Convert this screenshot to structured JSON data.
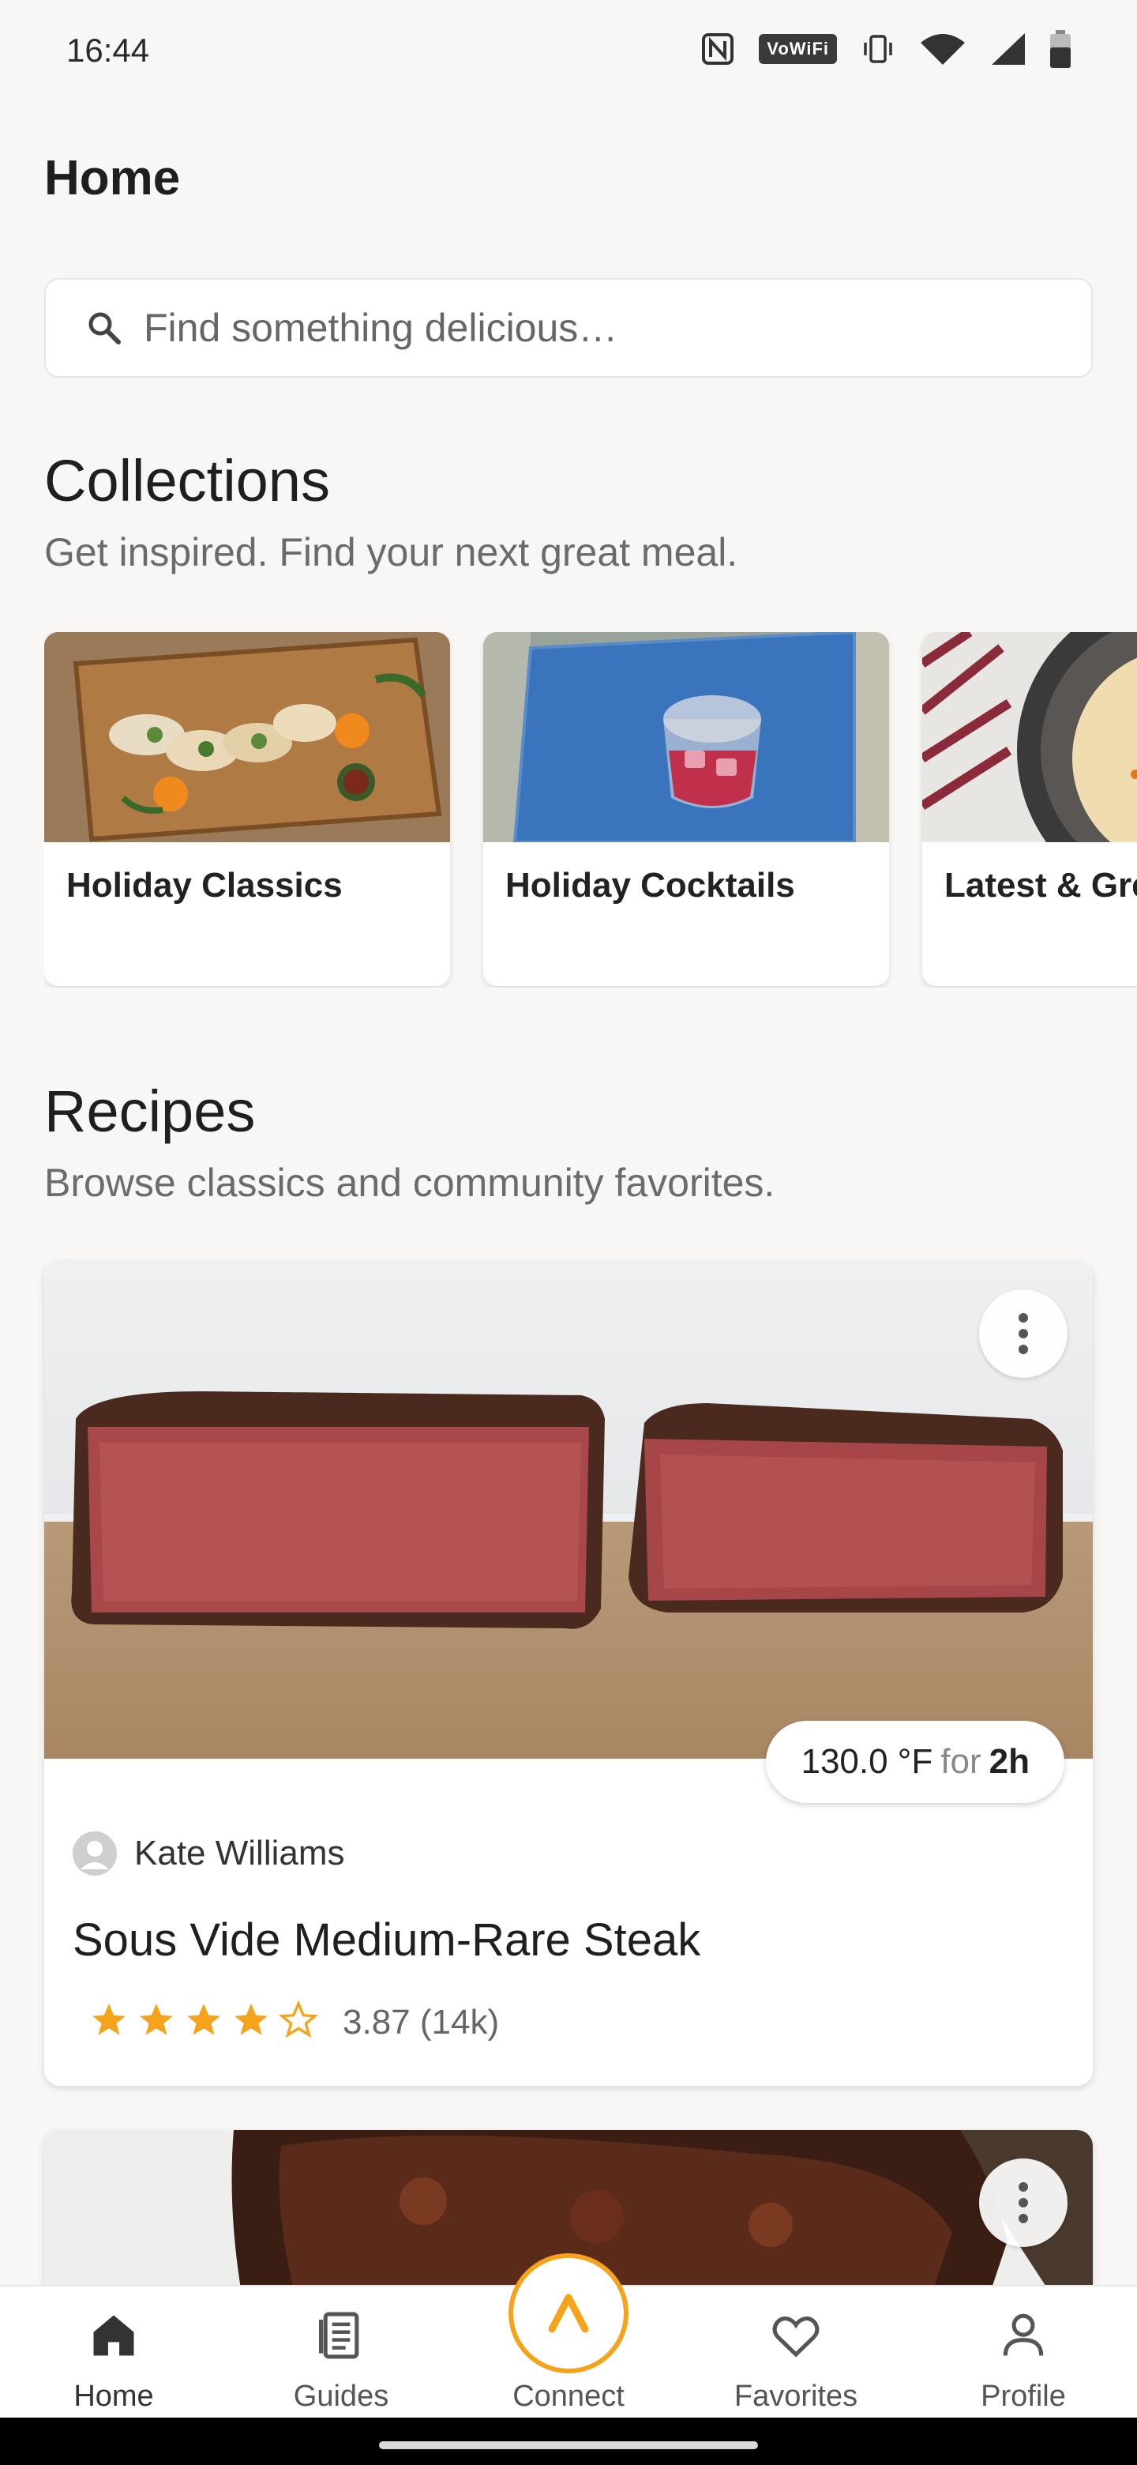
{
  "status_bar": {
    "time": "16:44",
    "wifi_badge": "VoWiFi"
  },
  "header": {
    "title": "Home"
  },
  "search": {
    "placeholder": "Find something delicious…"
  },
  "collections": {
    "title": "Collections",
    "subtitle": "Get inspired. Find your next great meal.",
    "items": [
      {
        "label": "Holiday Classics"
      },
      {
        "label": "Holiday Cocktails"
      },
      {
        "label": "Latest & Greatest"
      }
    ]
  },
  "recipes": {
    "title": "Recipes",
    "subtitle": "Browse classics and community favorites.",
    "items": [
      {
        "author": "Kate Williams",
        "title": "Sous Vide Medium-Rare Steak",
        "temp": "130.0 °F",
        "temp_for": "for",
        "duration": "2h",
        "rating_value": 3.87,
        "rating_text": "3.87 (14k)"
      }
    ]
  },
  "bottom_nav": {
    "items": [
      {
        "label": "Home",
        "icon": "home-icon"
      },
      {
        "label": "Guides",
        "icon": "guides-icon"
      },
      {
        "label": "Connect",
        "icon": "connect-icon"
      },
      {
        "label": "Favorites",
        "icon": "heart-icon"
      },
      {
        "label": "Profile",
        "icon": "person-icon"
      }
    ]
  },
  "colors": {
    "accent": "#f5a31a",
    "background": "#f8f7f5",
    "star": "#f5a31a"
  }
}
